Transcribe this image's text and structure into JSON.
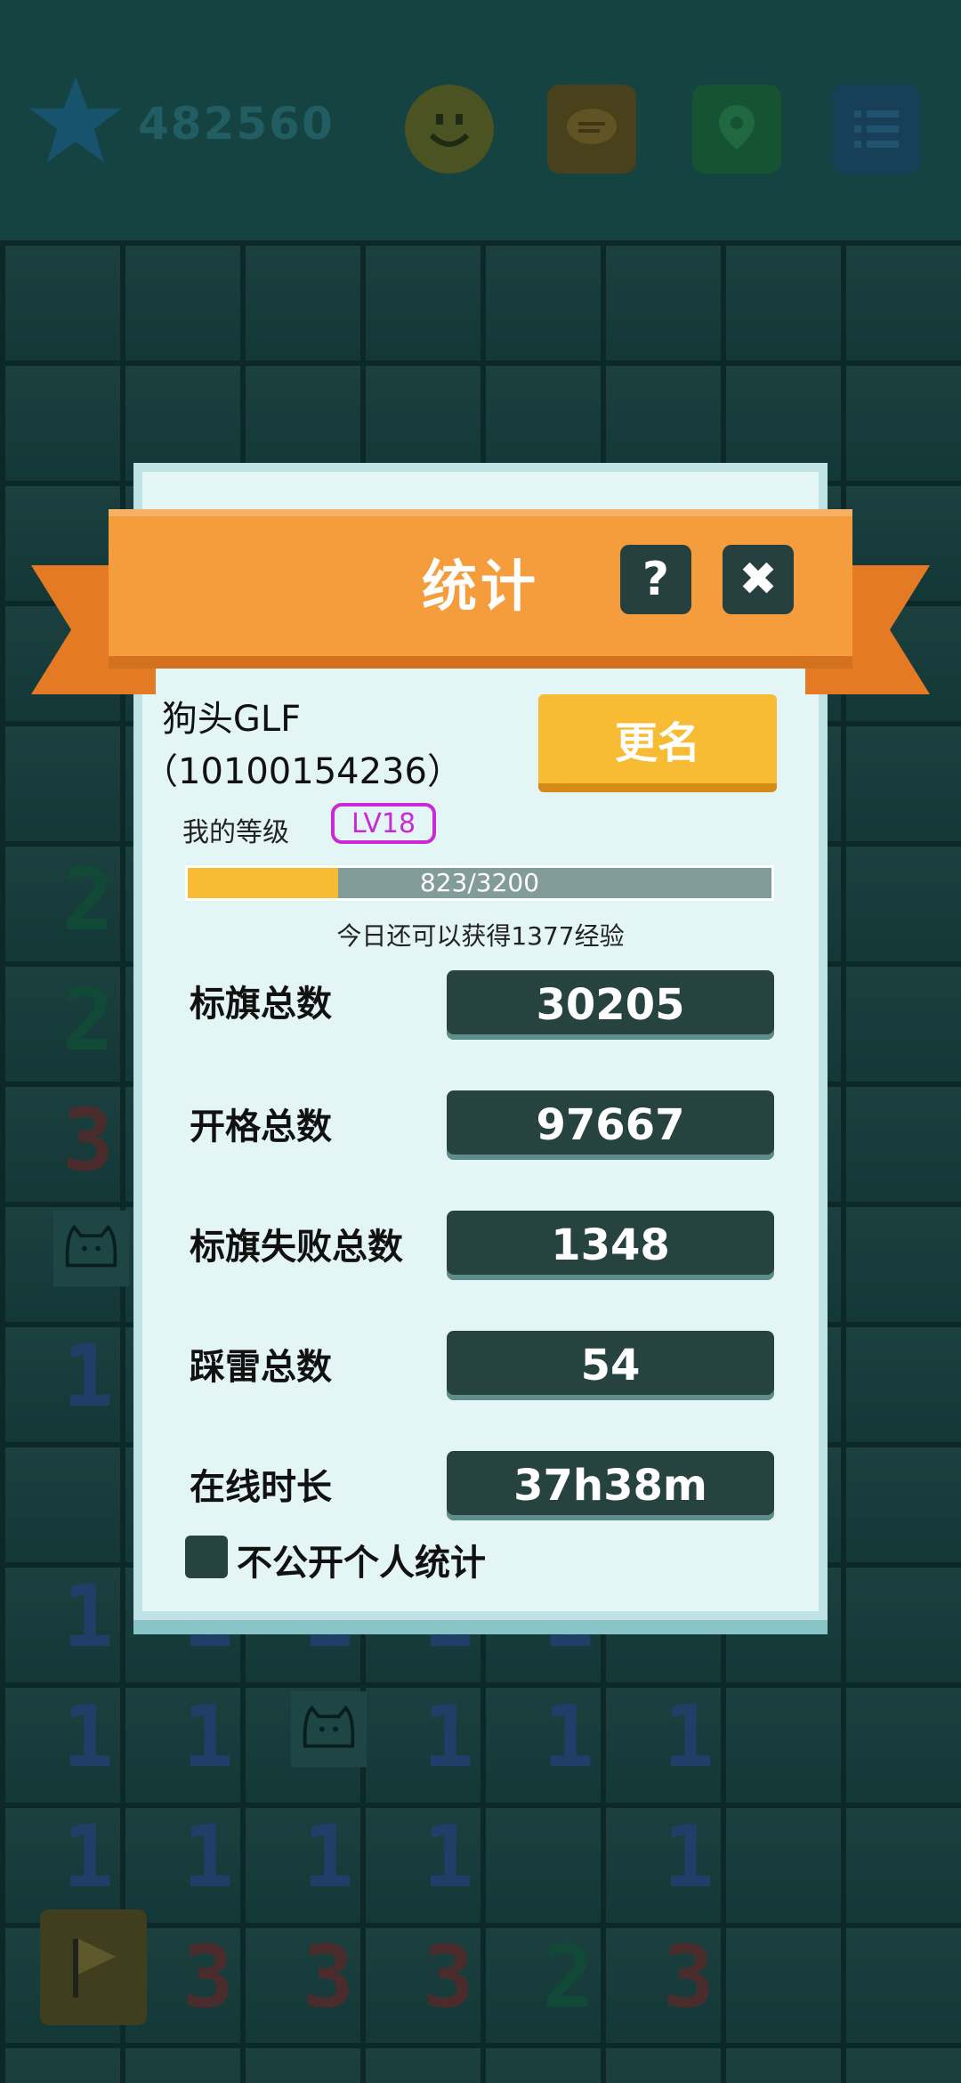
{
  "header": {
    "score": "482560",
    "icons": [
      "star-icon",
      "smile-icon",
      "chat-icon",
      "map-pin-icon",
      "list-icon"
    ]
  },
  "board": {
    "numbers": [
      "2",
      "2",
      "3",
      "1",
      "1",
      "1",
      "1",
      "1",
      "1",
      "1",
      "1",
      "1",
      "1",
      "1",
      "1",
      "1",
      "1",
      "1",
      "1",
      "3",
      "3",
      "3",
      "2",
      "3"
    ]
  },
  "dialog": {
    "title": "统计",
    "help_label": "?",
    "close_label": "✖",
    "player_name": "狗头GLF",
    "player_id": "（10100154236）",
    "rename_label": "更名",
    "level_label": "我的等级",
    "level": "LV18",
    "xp_text": "823/3200",
    "xp_progress": 0.257,
    "xp_hint": "今日还可以获得1377经验",
    "stats": [
      {
        "label": "标旗总数",
        "value": "30205"
      },
      {
        "label": "开格总数",
        "value": "97667"
      },
      {
        "label": "标旗失败总数",
        "value": "1348"
      },
      {
        "label": "踩雷总数",
        "value": "54"
      },
      {
        "label": "在线时长",
        "value": "37h38m"
      }
    ],
    "privacy_label": "不公开个人统计",
    "privacy_checked": false
  },
  "colors": {
    "ribbon": "#f59c3c",
    "rename_button": "#f7bc33",
    "stat_box": "#274340",
    "level_badge": "#c72ad6"
  }
}
